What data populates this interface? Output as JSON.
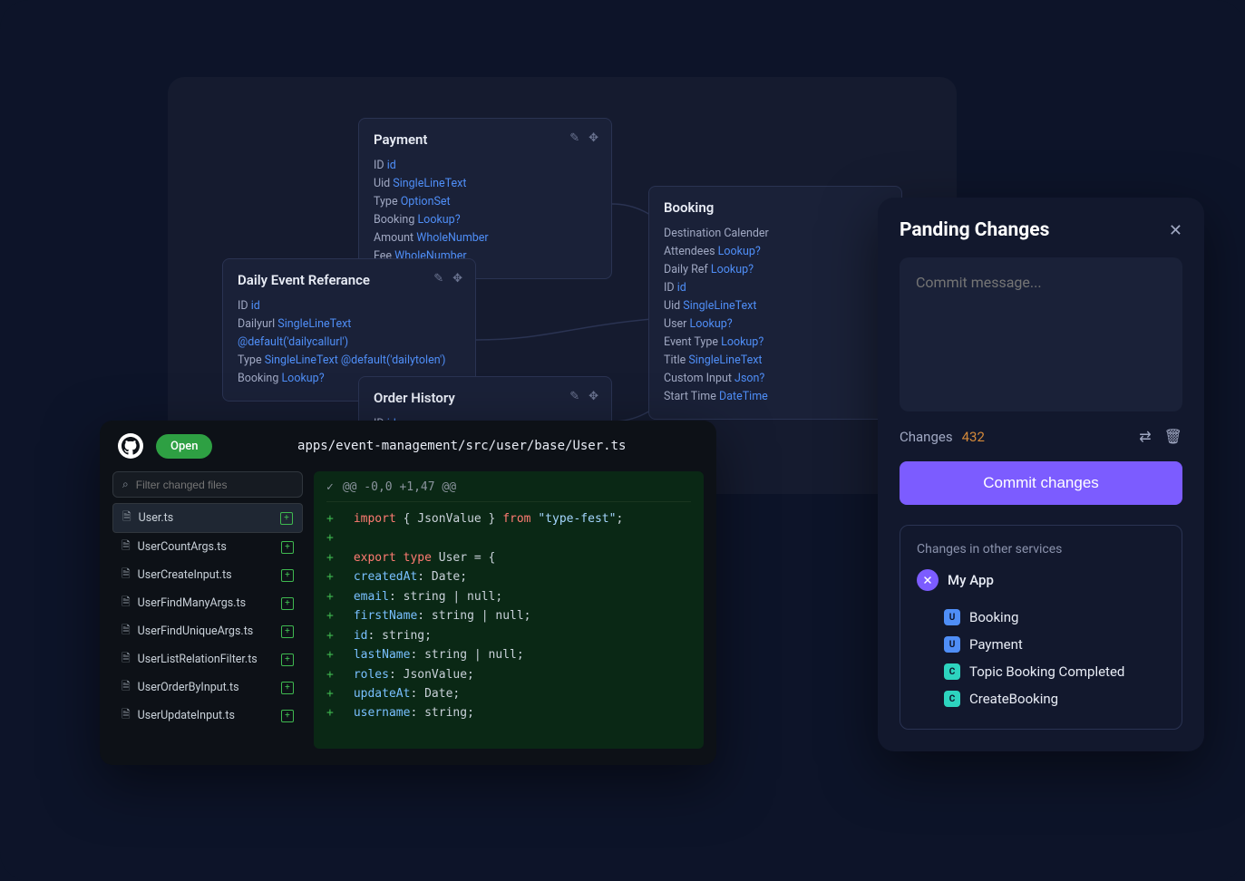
{
  "schema": {
    "payment": {
      "title": "Payment",
      "props": [
        {
          "k": "ID",
          "v": "id"
        },
        {
          "k": "Uid",
          "v": "SingleLineText"
        },
        {
          "k": "Type",
          "v": "OptionSet"
        },
        {
          "k": "Booking",
          "v": "Lookup?"
        },
        {
          "k": "Amount",
          "v": "WholeNumber"
        },
        {
          "k": "Fee",
          "v": "WholeNumber"
        }
      ]
    },
    "daily": {
      "title": "Daily Event Referance",
      "props": [
        {
          "k": "ID",
          "v": "id"
        },
        {
          "k": "Dailyurl",
          "v": "SingleLineText @default('dailycallurl')"
        },
        {
          "k": "Type",
          "v": "SingleLineText @default('dailytolen')"
        },
        {
          "k": "Booking",
          "v": "Lookup?"
        }
      ]
    },
    "order": {
      "title": "Order History",
      "props": [
        {
          "k": "ID",
          "v": "id"
        }
      ]
    },
    "booking": {
      "title": "Booking",
      "props": [
        {
          "k": "Destination Calender",
          "v": ""
        },
        {
          "k": "Attendees",
          "v": "Lookup?"
        },
        {
          "k": "Daily Ref",
          "v": "Lookup?"
        },
        {
          "k": "ID",
          "v": "id"
        },
        {
          "k": "Uid",
          "v": "SingleLineText"
        },
        {
          "k": "User",
          "v": "Lookup?"
        },
        {
          "k": "Event Type",
          "v": "Lookup?"
        },
        {
          "k": "Title",
          "v": "SingleLineText"
        },
        {
          "k": "Custom Input",
          "v": "Json?"
        },
        {
          "k": "Start Time",
          "v": "DateTime"
        }
      ]
    }
  },
  "github": {
    "open": "Open",
    "path": "apps/event-management/src/user/base/User.ts",
    "filter_placeholder": "Filter changed files",
    "files": [
      "User.ts",
      "UserCountArgs.ts",
      "UserCreateInput.ts",
      "UserFindManyArgs.ts",
      "UserFindUniqueArgs.ts",
      "UserListRelationFilter.ts",
      "UserOrderByInput.ts",
      "UserUpdateInput.ts"
    ],
    "diff_header": "@@ -0,0 +1,47 @@",
    "code": [
      {
        "t": [
          {
            "c": "import",
            "cls": "kw"
          },
          {
            "c": " { JsonValue } "
          },
          {
            "c": "from",
            "cls": "kw"
          },
          {
            "c": " \"type-fest\"",
            "cls": "st"
          },
          {
            "c": ";"
          }
        ]
      },
      {
        "t": []
      },
      {
        "t": [
          {
            "c": "export type",
            "cls": "kw"
          },
          {
            "c": " User = {"
          }
        ]
      },
      {
        "t": [
          {
            "c": "  createdAt",
            "cls": "pr"
          },
          {
            "c": ": Date;"
          }
        ]
      },
      {
        "t": [
          {
            "c": "  email",
            "cls": "pr"
          },
          {
            "c": ": string | null;"
          }
        ]
      },
      {
        "t": [
          {
            "c": "  firstName",
            "cls": "pr"
          },
          {
            "c": ": string | null;"
          }
        ]
      },
      {
        "t": [
          {
            "c": "  id",
            "cls": "pr"
          },
          {
            "c": ": string;"
          }
        ]
      },
      {
        "t": [
          {
            "c": "  lastName",
            "cls": "pr"
          },
          {
            "c": ": string | null;"
          }
        ]
      },
      {
        "t": [
          {
            "c": "  roles",
            "cls": "pr"
          },
          {
            "c": ": JsonValue;"
          }
        ]
      },
      {
        "t": [
          {
            "c": "  updateAt",
            "cls": "pr"
          },
          {
            "c": ": Date;"
          }
        ]
      },
      {
        "t": [
          {
            "c": "  username",
            "cls": "pr"
          },
          {
            "c": ": string;"
          }
        ]
      }
    ]
  },
  "pending": {
    "title": "Panding Changes",
    "commit_placeholder": "Commit message...",
    "changes_label": "Changes",
    "changes_count": "432",
    "commit_btn": "Commit changes",
    "other_title": "Changes in other services",
    "app_name": "My App",
    "services": [
      {
        "badge": "U",
        "type": "u",
        "name": "Booking"
      },
      {
        "badge": "U",
        "type": "u",
        "name": "Payment"
      },
      {
        "badge": "C",
        "type": "c",
        "name": "Topic Booking Completed"
      },
      {
        "badge": "C",
        "type": "c",
        "name": "CreateBooking"
      }
    ]
  }
}
